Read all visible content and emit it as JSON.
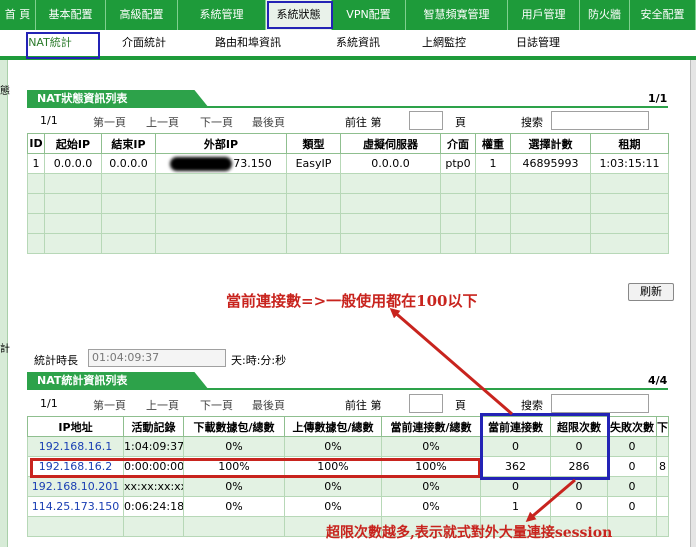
{
  "topnav": [
    "首 頁",
    "基本配置",
    "高級配置",
    "系統管理",
    "系統狀態",
    "VPN配置",
    "智慧頻寬管理",
    "用戶管理",
    "防火牆",
    "安全配置"
  ],
  "subnav": [
    "NAT統計",
    "介面統計",
    "路由和埠資訊",
    "系統資訊",
    "上網監控",
    "日誌管理"
  ],
  "left_strip_chars": [
    "態",
    "計"
  ],
  "nat_panel": {
    "title": "NAT狀態資訊列表",
    "page": "1/1",
    "pager": {
      "current": "1/1",
      "first": "第一頁",
      "prev": "上一頁",
      "next": "下一頁",
      "last": "最後頁",
      "goto": "前往 第",
      "page_unit": "頁",
      "search": "搜索"
    },
    "columns": [
      "ID",
      "起始IP",
      "結束IP",
      "外部IP",
      "類型",
      "虛擬伺服器",
      "介面",
      "權重",
      "選擇計數",
      "租期"
    ],
    "rows": [
      {
        "id": "1",
        "start_ip": "0.0.0.0",
        "end_ip": "0.0.0.0",
        "external_ip_suffix": "73.150",
        "type": "EasyIP",
        "virtual_server": "0.0.0.0",
        "interface": "ptp0",
        "weight": "1",
        "select_count": "46895993",
        "lease": "1:03:15:11"
      }
    ]
  },
  "refresh_button": "刷新",
  "stat_duration": {
    "label": "統計時長",
    "value": "01:04:09:37",
    "unit": "天:時:分:秒"
  },
  "stat_panel": {
    "title": "NAT統計資訊列表",
    "page": "4/4",
    "pager": {
      "current": "1/1",
      "first": "第一頁",
      "prev": "上一頁",
      "next": "下一頁",
      "last": "最後頁",
      "goto": "前往 第",
      "page_unit": "頁",
      "search": "搜索"
    },
    "columns": [
      "IP地址",
      "活動記錄",
      "下載數據包/總數",
      "上傳數據包/總數",
      "當前連接數/總數",
      "當前連接數",
      "超限次數",
      "失敗次數",
      "下"
    ],
    "rows": [
      {
        "ip": "192.168.16.1",
        "activity": "1:04:09:37",
        "download": "0%",
        "upload": "0%",
        "conn_ratio": "0%",
        "current_conn": "0",
        "over_limit": "0",
        "failed": "0",
        "extra": ""
      },
      {
        "ip": "192.168.16.2",
        "activity": "0:00:00:00",
        "download": "100%",
        "upload": "100%",
        "conn_ratio": "100%",
        "current_conn": "362",
        "over_limit": "286",
        "failed": "0",
        "extra": "8"
      },
      {
        "ip": "192.168.10.201",
        "activity": "xx:xx:xx:xx",
        "download": "0%",
        "upload": "0%",
        "conn_ratio": "0%",
        "current_conn": "0",
        "over_limit": "0",
        "failed": "0",
        "extra": ""
      },
      {
        "ip": "114.25.173.150",
        "activity": "0:06:24:18",
        "download": "0%",
        "upload": "0%",
        "conn_ratio": "0%",
        "current_conn": "1",
        "over_limit": "0",
        "failed": "0",
        "extra": ""
      }
    ]
  },
  "annotations": {
    "current_conn_note": "當前連接數=>一般使用都在100以下",
    "over_limit_note": "超限次數越多,表示就式對外大量連接session"
  },
  "colors": {
    "nav_green": "#1e9b3a",
    "highlight_blue": "#2323b5",
    "annotation_red": "#c8241e",
    "row_green": "#e3f2e3"
  }
}
